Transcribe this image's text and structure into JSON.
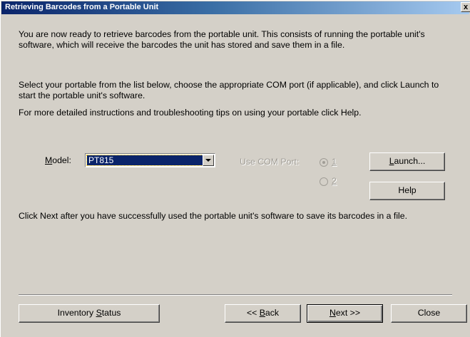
{
  "window": {
    "title": "Retrieving Barcodes from a Portable Unit",
    "close_glyph": "x"
  },
  "content": {
    "intro": "You are now ready to retrieve barcodes from the portable unit. This consists of running the portable unit's software, which will receive the barcodes the unit has stored and save them    in a file.",
    "select_instructions": "Select your portable from the list below, choose the appropriate COM port (if applicable), and click Launch to start the portable unit's software.",
    "help_instructions": "For more detailed instructions and troubleshooting tips on using your portable click Help.",
    "next_instructions": "Click Next after you have successfully used the portable unit's software to save its barcodes in a file."
  },
  "model": {
    "label_prefix": "M",
    "label_rest": "odel:",
    "selected": "PT815"
  },
  "com_port": {
    "label": "Use COM Port:",
    "options": [
      {
        "label": "1",
        "checked": true
      },
      {
        "label": "2",
        "checked": false
      }
    ],
    "enabled": false
  },
  "buttons": {
    "launch_prefix": "L",
    "launch_rest": "aunch...",
    "help": "Help",
    "inventory_pre": "Inventory ",
    "inventory_key": "S",
    "inventory_post": "tatus",
    "back_pre": "<< ",
    "back_key": "B",
    "back_post": "ack",
    "next_key": "N",
    "next_post": "ext >>",
    "close": "Close"
  },
  "colors": {
    "titlebar_start": "#0a246a",
    "titlebar_end": "#a6caf0",
    "face": "#d4d0c8",
    "selection": "#0a246a"
  }
}
